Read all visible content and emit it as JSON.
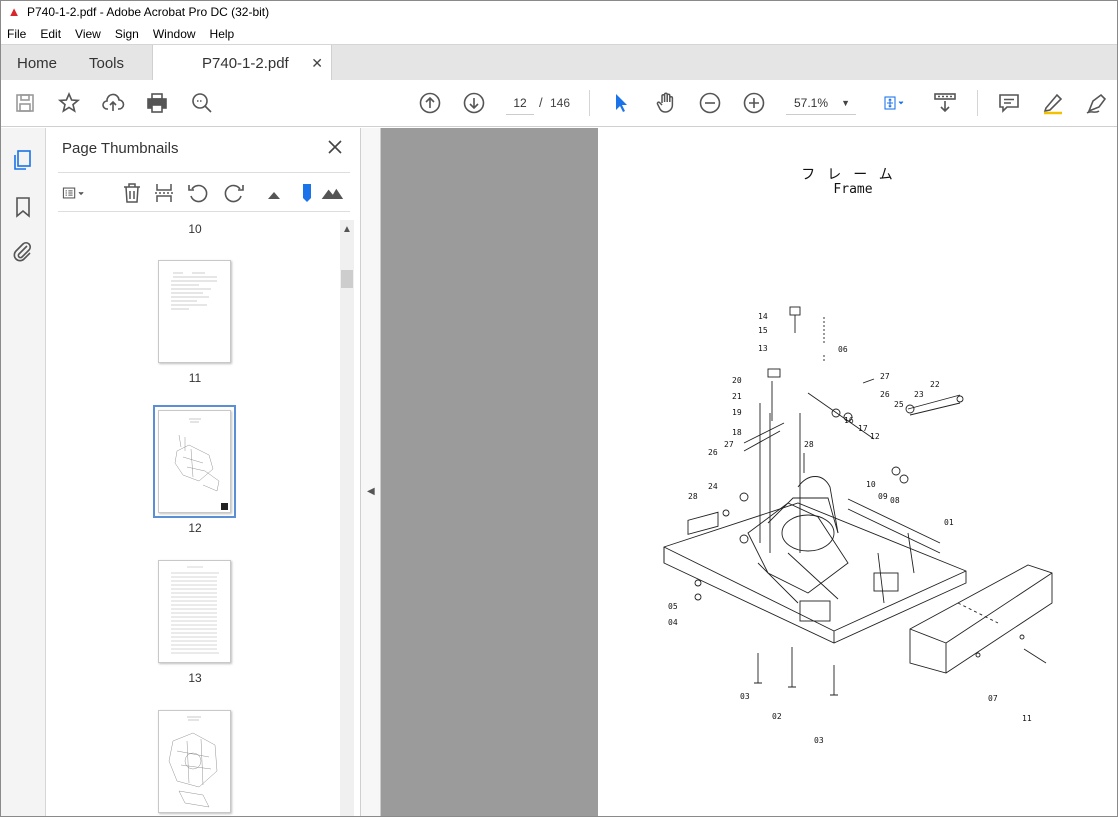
{
  "window": {
    "title": "P740-1-2.pdf - Adobe Acrobat Pro DC (32-bit)"
  },
  "menu": [
    "File",
    "Edit",
    "View",
    "Sign",
    "Window",
    "Help"
  ],
  "tabs": {
    "home": "Home",
    "tools": "Tools",
    "document": "P740-1-2.pdf"
  },
  "toolbar": {
    "page_current": "12",
    "page_sep": "/",
    "page_total": "146",
    "zoom": "57.1%"
  },
  "thumbnails": {
    "title": "Page Thumbnails",
    "pages": [
      {
        "label": "10"
      },
      {
        "label": "11"
      },
      {
        "label": "12",
        "selected": true
      },
      {
        "label": "13"
      }
    ]
  },
  "document": {
    "title_jp": "フレーム",
    "title_en": "Frame",
    "callouts": [
      "14",
      "15",
      "13",
      "06",
      "20",
      "21",
      "27",
      "22",
      "19",
      "26",
      "23",
      "18",
      "16",
      "17",
      "25",
      "27",
      "12",
      "28",
      "26",
      "10",
      "09",
      "08",
      "24",
      "28",
      "01",
      "05",
      "04",
      "03",
      "02",
      "07",
      "11",
      "03"
    ]
  },
  "colors": {
    "accent": "#1a73e8",
    "rail_bg": "#f4f4f4",
    "doc_bg": "#9b9b9b",
    "tab_bg": "#e5e5e5"
  }
}
